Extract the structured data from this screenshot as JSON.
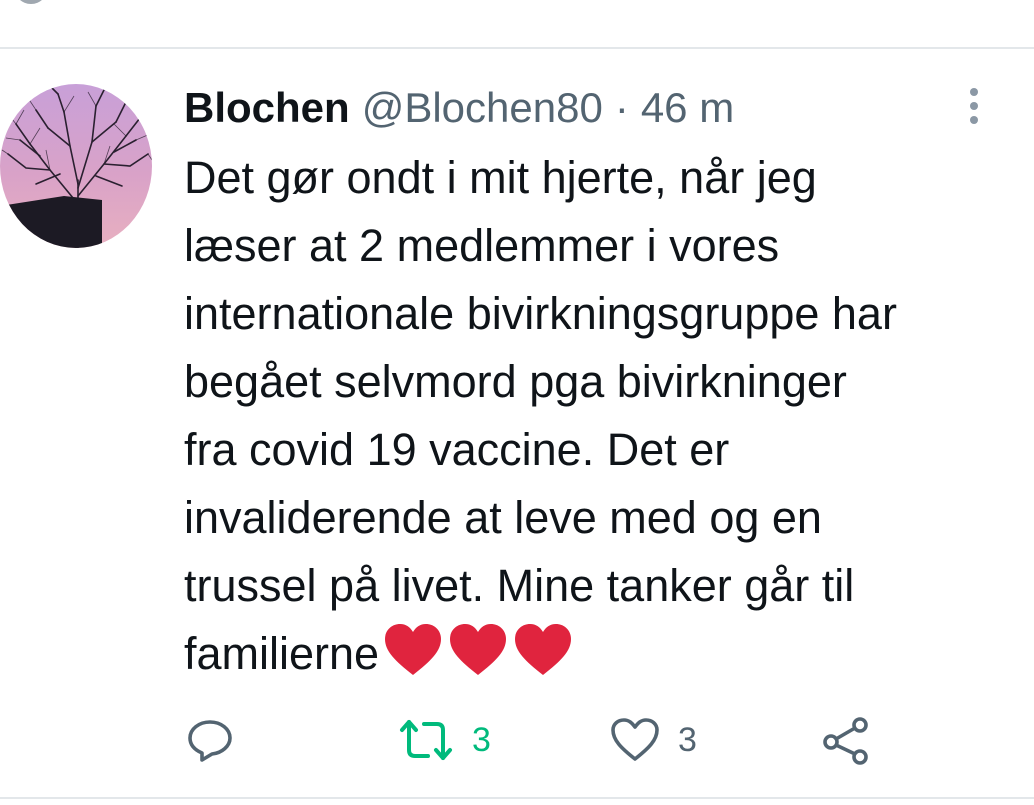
{
  "tweet": {
    "author_name": "Blochen",
    "author_handle": "@Blochen80",
    "separator": "·",
    "timestamp": "46 m",
    "text_lines": [
      "Det gør ondt i mit hjerte, når jeg",
      "læser at 2 medlemmer i vores",
      "internationale bivirkningsgruppe har",
      "begået selvmord pga bivirkninger",
      "fra covid 19 vaccine. Det er",
      "invaliderende at leve med og en",
      "trussel på livet. Mine tanker går til",
      "familierne"
    ],
    "trailing_emoji": [
      "red-heart",
      "red-heart",
      "red-heart"
    ]
  },
  "actions": {
    "reply": {
      "icon": "reply-icon"
    },
    "retweet": {
      "icon": "retweet-icon",
      "count": "3"
    },
    "like": {
      "icon": "heart-outline-icon",
      "count": "3"
    },
    "share": {
      "icon": "share-icon"
    }
  },
  "colors": {
    "text": "#0f1419",
    "secondary": "#536471",
    "retweet_green": "#00ba7c",
    "heart_red": "#e0243e",
    "divider": "#e3e7ea"
  }
}
